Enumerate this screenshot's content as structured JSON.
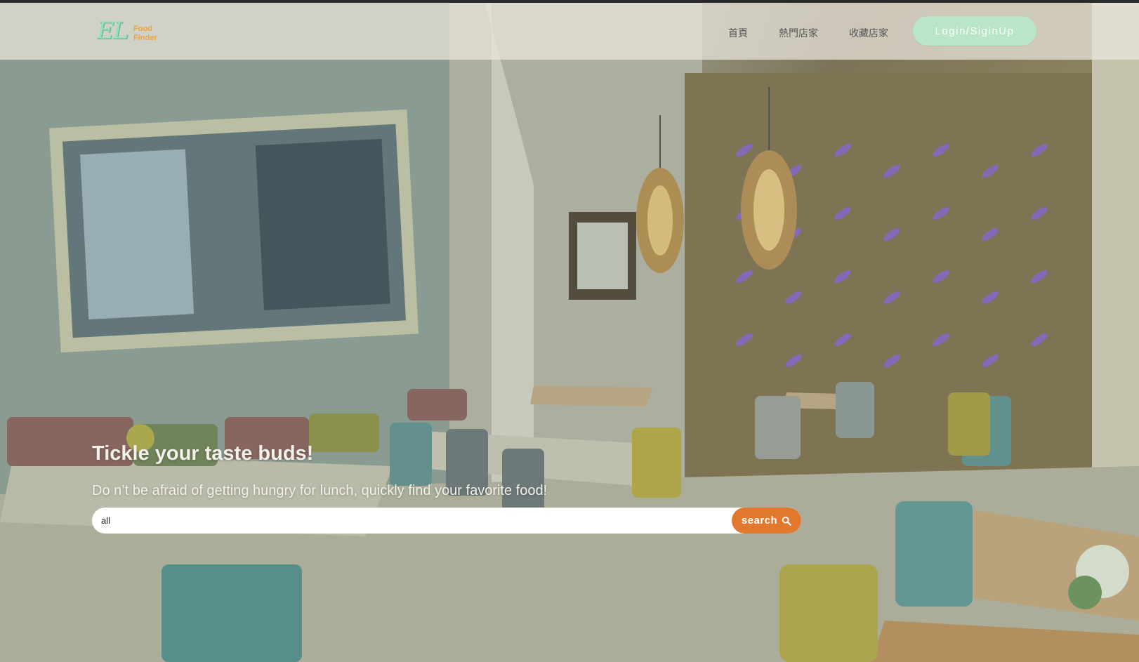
{
  "brand": {
    "logo_mark": "EL",
    "logo_line1": "Food",
    "logo_line2": "Finder"
  },
  "nav": {
    "items": [
      {
        "label": "首頁"
      },
      {
        "label": "熱門店家"
      },
      {
        "label": "收藏店家"
      }
    ],
    "login_label": "Login/SiginUp"
  },
  "hero": {
    "title": "Tickle your taste buds!",
    "subtitle": "Do n’t be afraid of getting hungry for lunch, quickly find your favorite food!",
    "search_value": "all",
    "search_button_label": "search"
  },
  "colors": {
    "accent": "#e2772e",
    "login_button": "#b8e6c6",
    "logo_green": "#8fe3b8",
    "logo_orange": "#f0a238"
  }
}
